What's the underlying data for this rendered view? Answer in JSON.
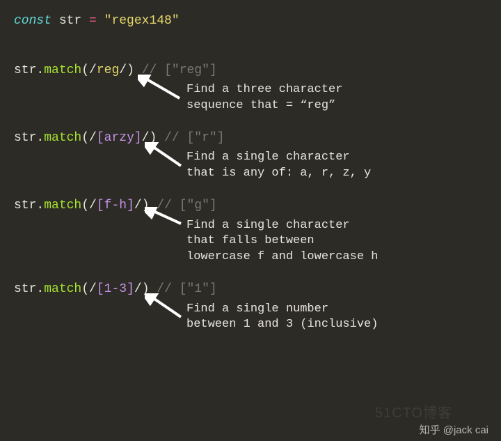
{
  "decl": {
    "const": "const",
    "varname": " str ",
    "eq": "=",
    "strlit": " \"regex148\""
  },
  "examples": [
    {
      "obj": "str",
      "dot": ".",
      "method": "match",
      "open": "(",
      "rd1": "/",
      "body": "reg",
      "class": "",
      "rd2": "/",
      "close": ")",
      "comment": " // [\"reg\"]",
      "annot": "Find a three character\nsequence that = “reg”"
    },
    {
      "obj": "str",
      "dot": ".",
      "method": "match",
      "open": "(",
      "rd1": "/",
      "body": "",
      "class": "[arzy]",
      "rd2": "/",
      "close": ")",
      "comment": " // [\"r\"]",
      "annot": "Find a single character\nthat is any of: a, r, z, y"
    },
    {
      "obj": "str",
      "dot": ".",
      "method": "match",
      "open": "(",
      "rd1": "/",
      "body": "",
      "class": "[f-h]",
      "rd2": "/",
      "close": ")",
      "comment": " // [\"g\"]",
      "annot": "Find a single character\nthat falls between\nlowercase f and lowercase h"
    },
    {
      "obj": "str",
      "dot": ".",
      "method": "match",
      "open": "(",
      "rd1": "/",
      "body": "",
      "class": "[1-3]",
      "rd2": "/",
      "close": ")",
      "comment": " // [\"1\"]",
      "annot": "Find a single number\nbetween 1 and 3 (inclusive)"
    }
  ],
  "watermark_bg": "51CTO博客",
  "watermark": "知乎 @jack cai"
}
